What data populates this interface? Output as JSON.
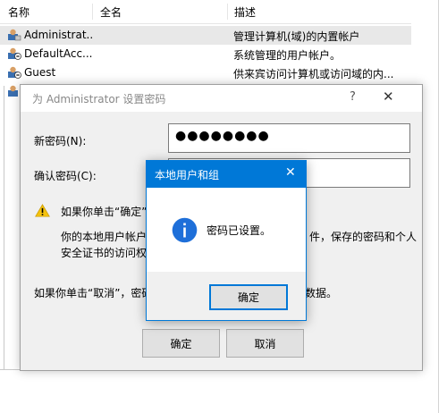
{
  "list": {
    "columns": [
      "名称",
      "全名",
      "描述"
    ],
    "rows": [
      {
        "name": "Administrat...",
        "full_name": "",
        "desc": "管理计算机(域)的内置帐户",
        "selected": true
      },
      {
        "name": "DefaultAcc...",
        "full_name": "",
        "desc": "系统管理的用户帐户。",
        "selected": false
      },
      {
        "name": "Guest",
        "full_name": "",
        "desc": "供来宾访问计算机或访问域的内...",
        "selected": false
      },
      {
        "name": "",
        "full_name": "",
        "desc": "",
        "selected": false
      }
    ]
  },
  "password_dialog": {
    "title": "为 Administrator 设置密码",
    "help_glyph": "?",
    "close_glyph": "✕",
    "new_password_label": "新密码(N):",
    "new_password_value": "●●●●●●●●",
    "confirm_password_label": "确认密码(C):",
    "confirm_password_value": "",
    "warning_text": "如果你单击“确定”",
    "info_line1": "你的本地用户帐户",
    "info_line1_tail": "件，保存的密码和个人",
    "info_line2": "安全证书的访问权",
    "cancel_note": "如果你单击“取消”，密码",
    "cancel_note_tail": "数据。",
    "ok_label": "确定",
    "cancel_label": "取消"
  },
  "message_box": {
    "title": "本地用户和组",
    "close_glyph": "✕",
    "message": "密码已设置。",
    "icon": "info-icon",
    "ok_label": "确定"
  },
  "colors": {
    "accent": "#0078d7",
    "dialog_bg": "#f0f0f0",
    "selected_row": "#e8e8e8",
    "warning": "#f4c20d"
  }
}
